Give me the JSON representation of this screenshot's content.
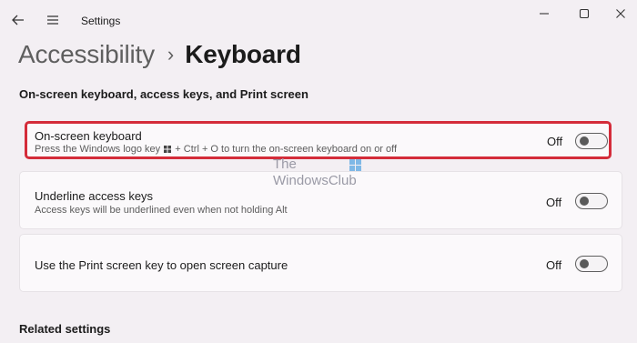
{
  "window": {
    "title": "Settings"
  },
  "breadcrumb": {
    "parent": "Accessibility",
    "separator": "›",
    "current": "Keyboard"
  },
  "section": {
    "heading": "On-screen keyboard, access keys, and Print screen"
  },
  "settings": [
    {
      "title": "On-screen keyboard",
      "description_before_icon": "Press the Windows logo key",
      "description_after_icon": "+ Ctrl + O to turn the on-screen keyboard on or off",
      "toggle_label": "Off",
      "toggle_on": false,
      "highlighted": true
    },
    {
      "title": "Underline access keys",
      "description": "Access keys will be underlined even when not holding Alt",
      "toggle_label": "Off",
      "toggle_on": false
    },
    {
      "title": "Use the Print screen key to open screen capture",
      "toggle_label": "Off",
      "toggle_on": false
    }
  ],
  "watermark": {
    "line1": "The",
    "line2": "WindowsClub"
  },
  "related": {
    "heading": "Related settings"
  },
  "colors": {
    "highlight_border": "#d42c3a",
    "background": "#f3eff3",
    "card": "#fbf9fb"
  },
  "icons": {
    "back": "back-arrow-icon",
    "menu": "hamburger-menu-icon",
    "minimize": "minimize-icon",
    "maximize": "maximize-icon",
    "close": "close-icon",
    "windows_key": "windows-logo-icon"
  }
}
